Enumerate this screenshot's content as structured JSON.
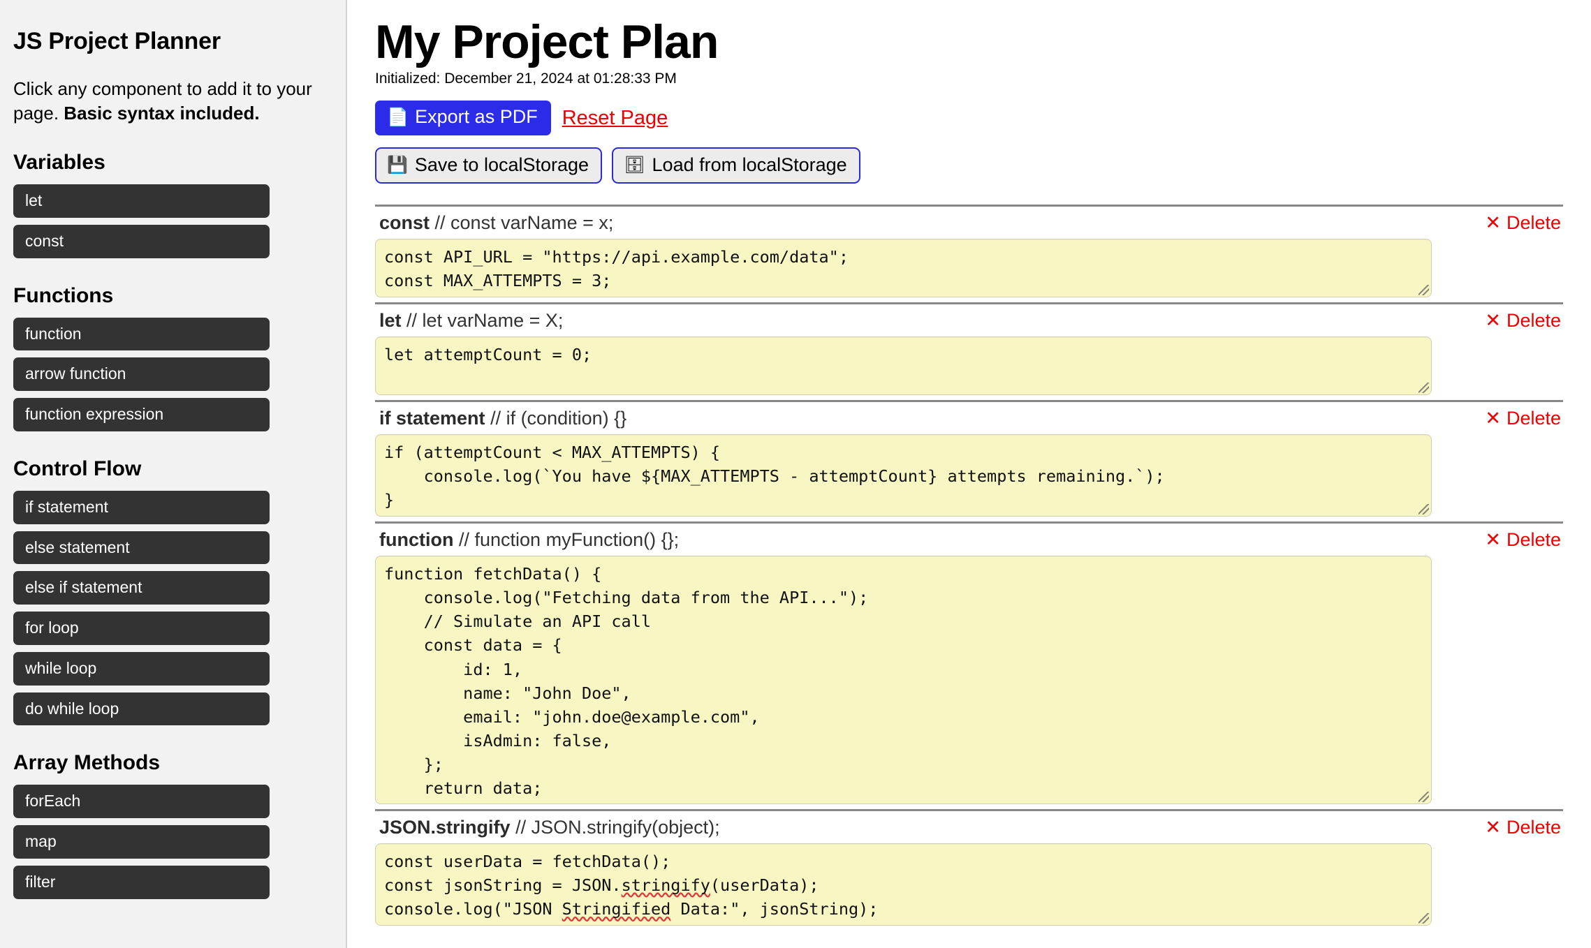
{
  "sidebar": {
    "title": "JS Project Planner",
    "intro_plain": "Click any component to add it to your page. ",
    "intro_bold": "Basic syntax included.",
    "sections": [
      {
        "heading": "Variables",
        "items": [
          "let",
          "const"
        ]
      },
      {
        "heading": "Functions",
        "items": [
          "function",
          "arrow function",
          "function expression"
        ]
      },
      {
        "heading": "Control Flow",
        "items": [
          "if statement",
          "else statement",
          "else if statement",
          "for loop",
          "while loop",
          "do while loop"
        ]
      },
      {
        "heading": "Array Methods",
        "items": [
          "forEach",
          "map",
          "filter"
        ]
      }
    ]
  },
  "header": {
    "title": "My Project Plan",
    "subtitle": "Initialized: December 21, 2024 at 01:28:33 PM",
    "export_label": "Export as PDF",
    "export_icon": "page-facing-up",
    "export_icon_glyph": "📄",
    "export_bg": "#2c2ce8",
    "reset_label": "Reset Page",
    "reset_color": "#ee0000",
    "save_label": "Save to localStorage",
    "save_icon": "floppy-disk",
    "save_icon_glyph": "💾",
    "load_label": "Load from localStorage",
    "load_icon": "file-cabinet",
    "load_icon_glyph": "🗄",
    "button_border_color": "#2a2ae0"
  },
  "delete_label": "Delete",
  "delete_icon_glyph": "✕",
  "blocks": [
    {
      "keyword": "const",
      "comment": "// const varName = x;",
      "code": "const API_URL = \"https://api.example.com/data\";\nconst MAX_ATTEMPTS = 3;",
      "rows": 2
    },
    {
      "keyword": "let",
      "comment": "// let varName = X;",
      "code": "let attemptCount = 0;",
      "rows": 2
    },
    {
      "keyword": "if statement",
      "comment": "// if (condition) {}",
      "code": "if (attemptCount < MAX_ATTEMPTS) {\n    console.log(`You have ${MAX_ATTEMPTS - attemptCount} attempts remaining.`);\n}",
      "rows": 3
    },
    {
      "keyword": "function",
      "comment": "// function myFunction() {};",
      "code": "function fetchData() {\n    console.log(\"Fetching data from the API...\");\n    // Simulate an API call\n    const data = {\n        id: 1,\n        name: \"John Doe\",\n        email: \"john.doe@example.com\",\n        isAdmin: false,\n    };\n    return data;\n}",
      "rows": 10
    },
    {
      "keyword": "JSON.stringify",
      "comment": "// JSON.stringify(object);",
      "code": "const userData = fetchData();\nconst jsonString = JSON.stringify(userData);\nconsole.log(\"JSON Stringified Data:\", jsonString);",
      "rows": 3,
      "spellcheck_words": [
        "stringify",
        "Stringified"
      ]
    }
  ],
  "colors": {
    "sidebar_bg": "#f2f2f2",
    "sidebar_button_bg": "#333333",
    "code_bg": "#f8f7c4",
    "divider": "#888888"
  }
}
